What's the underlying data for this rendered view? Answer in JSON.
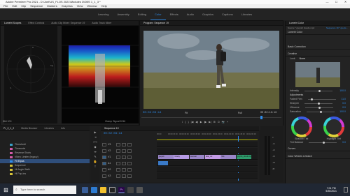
{
  "window": {
    "title": "Adobe Premiere Pro 2021 - D:\\Joel\\US_FLOS 2021\\Modules 3\\OBS 1_1_3 *",
    "controls": [
      "—",
      "☐",
      "✕"
    ]
  },
  "menubar": [
    "File",
    "Edit",
    "Clip",
    "Sequence",
    "Markers",
    "Graphics",
    "View",
    "Window",
    "Help"
  ],
  "workspaces": {
    "items": [
      "Learning",
      "Assembly",
      "Editing",
      "Color",
      "Effects",
      "Audio",
      "Graphics",
      "Captions",
      "Libraries"
    ],
    "active": "Color"
  },
  "source_panel": {
    "tabs": [
      "Lumetri Scopes",
      "Effect Controls",
      "Audio Clip Mixer: Sequence 19",
      "Audio Track Mixer"
    ],
    "active_tab": "Lumetri Scopes",
    "footer_left": "8bit  100",
    "footer_right": "Clamp Signal  8 Bit"
  },
  "program": {
    "tab": "Program: Sequence 19",
    "timecode_current": "00:02:03:14",
    "fit": "Fit",
    "quality": "Full",
    "timecode_duration": "00:02:13:13",
    "transport": [
      "⟟",
      "{",
      "}",
      "|◀",
      "◀|",
      "▶",
      "|▶",
      "▶|",
      "⊞",
      "⊡",
      "📷",
      "+"
    ]
  },
  "lumetri": {
    "tab": "Lumetri Color",
    "source_line": "Source * greyish clouds.mp4",
    "seq_line": "Sequence 19 * greyis...",
    "effect_label": "Lumetri Color",
    "basic_correction": "Basic Correction",
    "creative": "Creative",
    "look_label": "Look",
    "look_value": "None",
    "intensity": {
      "label": "Intensity",
      "value": "100.0"
    },
    "adjustments": "Adjustments",
    "sliders": [
      {
        "label": "Faded Film",
        "value": "11.0",
        "pos": 0.12
      },
      {
        "label": "Sharpen",
        "value": "0.0",
        "pos": 0.5
      },
      {
        "label": "Vibrance",
        "value": "0.0",
        "pos": 0.5
      },
      {
        "label": "Saturation",
        "value": "100.0",
        "pos": 0.5
      }
    ],
    "wheel_left_label": "Shadow Tint",
    "wheel_right_label": "Highlight Tint",
    "tint_balance": {
      "label": "Tint Balance",
      "value": "0.0"
    },
    "curves": "Curves",
    "color_wheels": "Color Wheels & Match"
  },
  "project": {
    "tabs": [
      "Pr_2_1_2",
      "Media Browser",
      "Libraries",
      "Info"
    ],
    "items": [
      {
        "name": "Threshold",
        "color": "#3aa1c8"
      },
      {
        "name": "Timecode",
        "color": "#d05aa8"
      },
      {
        "name": "Reverse Shots",
        "color": "#d05aa8"
      },
      {
        "name": "Video Limiter (legacy)",
        "color": "#d05aa8"
      },
      {
        "name": "Fit Elpas",
        "color": "#2d8ceb",
        "selected": true
      },
      {
        "name": "Sequence",
        "color": "#d4c23a"
      },
      {
        "name": "Hi Angle Walk",
        "color": "#d4c23a"
      },
      {
        "name": "Hi Pop-ins",
        "color": "#d4c23a"
      }
    ]
  },
  "timeline": {
    "tab": "Sequence 19",
    "timecode": "00:02:03:14",
    "ruler": [
      "00:00",
      "00:00:15:00",
      "00:00:30:00",
      "00:00:45:00",
      "00:01:00:00",
      "00:01:15:00",
      "00:01:30:00",
      "00:01:45:00",
      "00:02:00:00"
    ],
    "tracks": [
      {
        "name": "V3"
      },
      {
        "name": "V2"
      },
      {
        "name": "V1",
        "clips": [
          "greyish",
          "Cloudy",
          "overcast",
          "fade_out",
          "hills",
          "greyish_clouds.mp4"
        ]
      },
      {
        "name": "A1"
      },
      {
        "name": "A2"
      },
      {
        "name": "A3"
      }
    ]
  },
  "meters": {
    "labels": [
      "0",
      "-12",
      "-24",
      "-36",
      "-48",
      "dB"
    ]
  },
  "taskbar": {
    "search_placeholder": "Type here to search",
    "time": "7:01 PM",
    "date": "5/30/2021"
  }
}
